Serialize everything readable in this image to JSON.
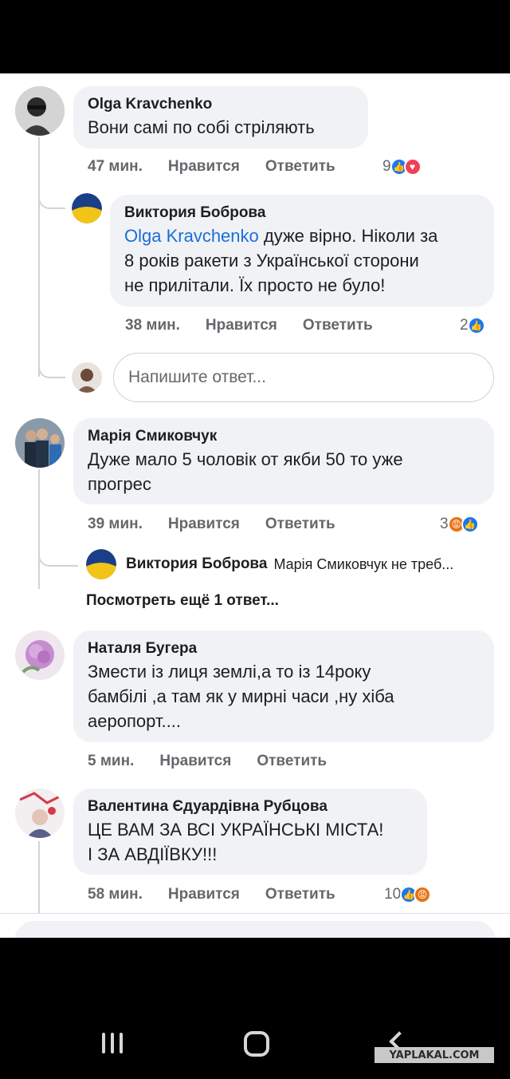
{
  "comments": [
    {
      "author": "Olga Kravchenko",
      "text": "Вони самі по собі стріляють",
      "time": "47 мин.",
      "like": "Нравится",
      "reply": "Ответить",
      "reaction_count": "9",
      "reactions": [
        "like",
        "love"
      ],
      "replies": [
        {
          "author": "Виктория Боброва",
          "mention": "Olga Kravchenko",
          "text_line1": " дуже вірно. Ніколи за",
          "text_line2": "8 років ракети з Української сторони",
          "text_line3": "не прилітали. Їх просто не було!",
          "time": "38 мин.",
          "like": "Нравится",
          "reply": "Ответить",
          "reaction_count": "2",
          "reactions": [
            "like"
          ]
        }
      ],
      "reply_placeholder": "Напишите ответ..."
    },
    {
      "author": "Марія Смиковчук",
      "text_line1": "Дуже мало 5 чоловік от якби 50 то уже",
      "text_line2": "прогрес",
      "time": "39 мин.",
      "like": "Нравится",
      "reply": "Ответить",
      "reaction_count": "3",
      "reactions": [
        "angry",
        "like"
      ],
      "collapsed_reply": {
        "author": "Виктория Боброва",
        "text": "Марія Смиковчук не треб..."
      },
      "more_replies": "Посмотреть ещё 1 ответ..."
    },
    {
      "author": "Наталя Бугера",
      "text_line1": "Змести із лиця землі,а то із 14року",
      "text_line2": "бамбілі ,а там як у мирні часи ,ну хіба",
      "text_line3": "аеропорт....",
      "time": "5 мин.",
      "like": "Нравится",
      "reply": "Ответить"
    },
    {
      "author": "Валентина Єдуардівна Рубцова",
      "text_line1": "ЦЕ ВАМ ЗА ВСІ УКРАЇНСЬКІ МІСТА!",
      "text_line2": "І ЗА АВДІЇВКУ!!!",
      "time": "58 мин.",
      "like": "Нравится",
      "reply": "Ответить",
      "reaction_count": "10",
      "reactions": [
        "like",
        "angry"
      ]
    }
  ],
  "watermark": "YAPLAKAL.COM",
  "colors": {
    "bubble": "#f0f2f5",
    "mention": "#1a6ed8",
    "like": "#1877f2",
    "love": "#f33e58",
    "angry": "#e9710f"
  }
}
